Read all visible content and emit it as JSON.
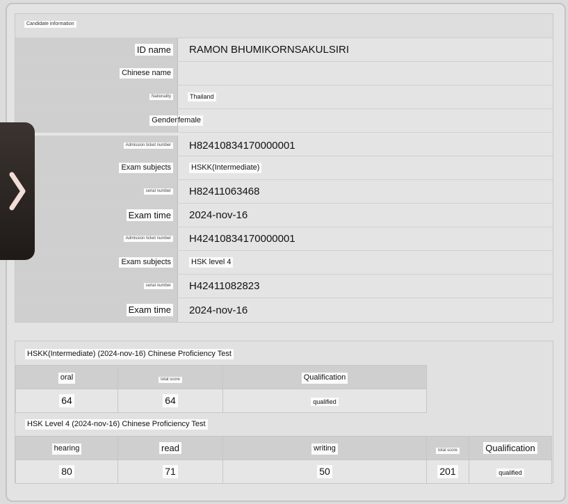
{
  "candidate": {
    "section_title": "Candidate information",
    "id_name_label": "ID name",
    "id_name_value": "RAMON BHUMIKORNSAKULSIRI",
    "chinese_name_label": "Chinese name",
    "chinese_name_value": "",
    "nationality_label": "Nationality",
    "nationality_value": "Thailand",
    "gender_label": "Gender",
    "gender_value": "female",
    "admission_1_label": "Admission ticket number",
    "admission_1_value": "H82410834170000001",
    "subjects_1_label": "Exam subjects",
    "subjects_1_value": "HSKK(Intermediate)",
    "serial_1_label": "serial number",
    "serial_1_value": "H82411063468",
    "time_1_label": "Exam time",
    "time_1_value": "2024-nov-16",
    "admission_2_label": "Admission ticket number",
    "admission_2_value": "H42410834170000001",
    "subjects_2_label": "Exam subjects",
    "subjects_2_value": "HSK level 4",
    "serial_2_label": "serial number",
    "serial_2_value": "H42411082823",
    "time_2_label": "Exam time",
    "time_2_value": "2024-nov-16"
  },
  "hskk": {
    "title": "HSKK(Intermediate) (2024-nov-16) Chinese Proficiency Test",
    "headers": [
      "oral",
      "total score",
      "Qualification"
    ],
    "values": [
      "64",
      "64",
      "qualified"
    ]
  },
  "hsk": {
    "title": "HSK Level 4 (2024-nov-16) Chinese Proficiency Test",
    "headers": [
      "hearing",
      "read",
      "writing",
      "total score",
      "Qualification"
    ],
    "values": [
      "80",
      "71",
      "50",
      "201",
      "qualified"
    ]
  },
  "icons": {
    "handle": "chevron-right-icon"
  }
}
